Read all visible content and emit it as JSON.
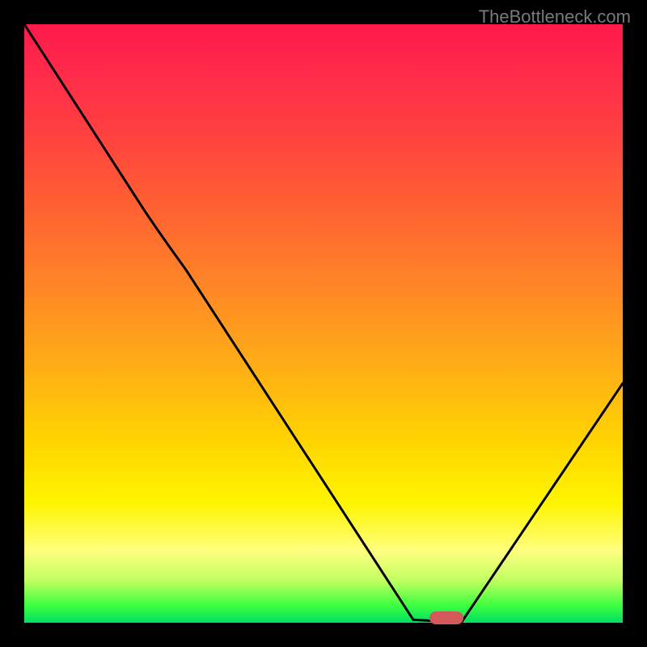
{
  "watermark": "TheBottleneck.com",
  "chart_data": {
    "type": "line",
    "title": "",
    "xlabel": "",
    "ylabel": "",
    "x_range": [
      0,
      100
    ],
    "y_range": [
      0,
      100
    ],
    "curve_points": [
      {
        "x": 0,
        "y": 100
      },
      {
        "x": 20,
        "y": 69
      },
      {
        "x": 27,
        "y": 59
      },
      {
        "x": 65,
        "y": 0.5
      },
      {
        "x": 73,
        "y": 0
      },
      {
        "x": 100,
        "y": 40
      }
    ],
    "minimum_marker": {
      "x": 70,
      "y": 0
    },
    "background_gradient": "red-yellow-green (bottleneck heatmap)"
  }
}
